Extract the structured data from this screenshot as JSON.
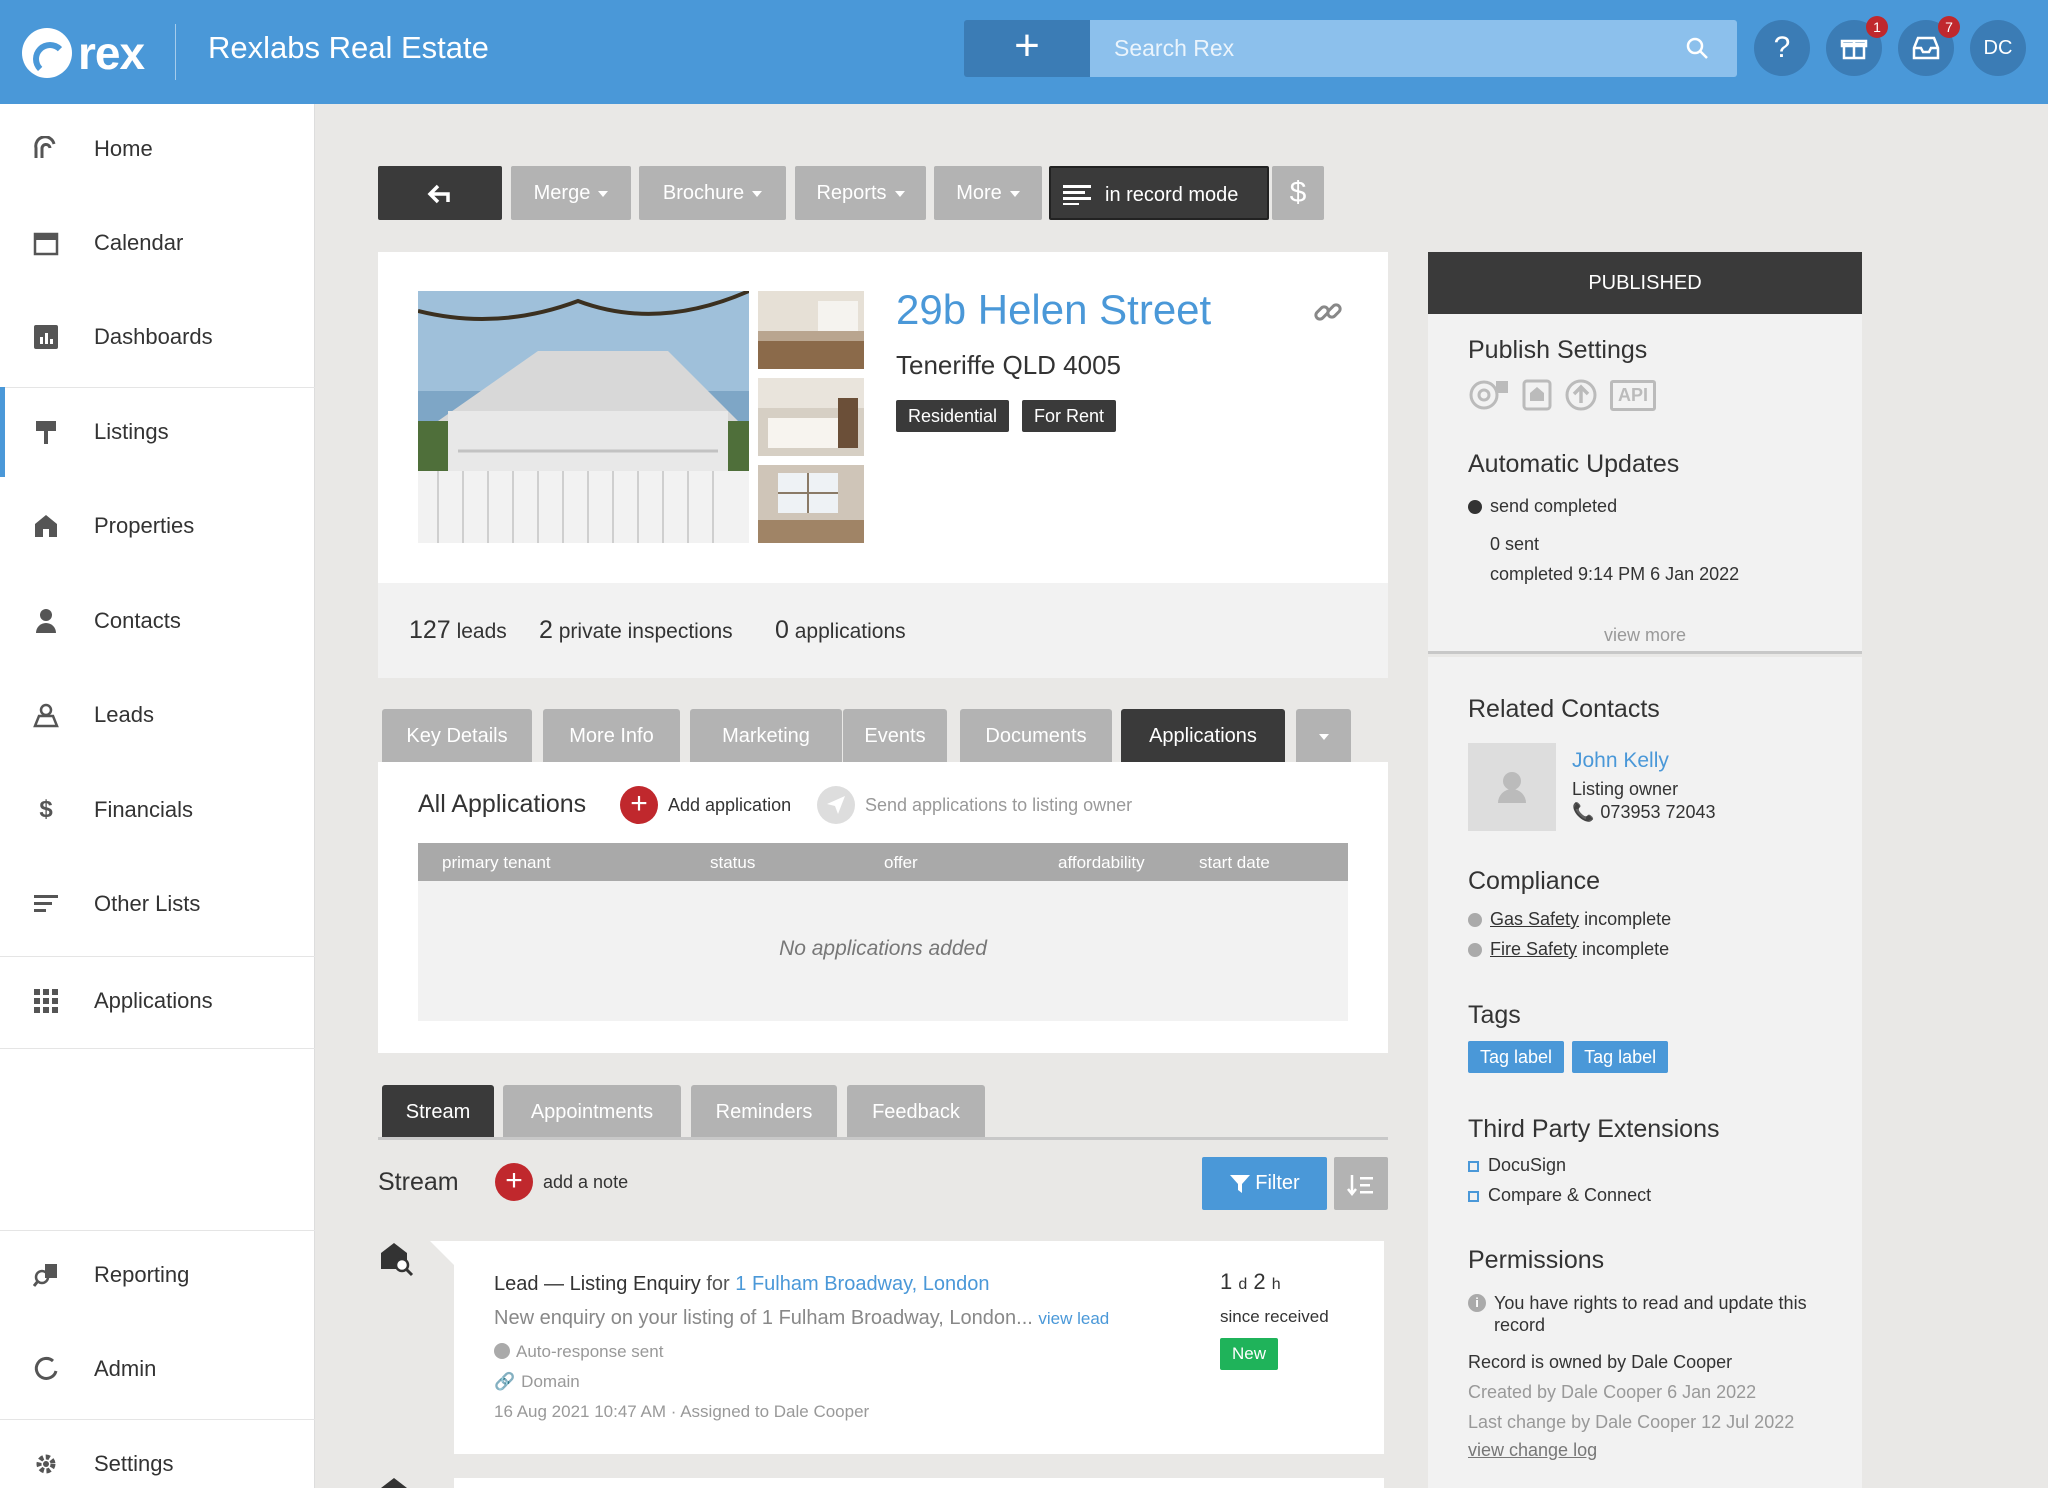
{
  "app": {
    "logo_text": "rex",
    "agency": "Rexlabs Real Estate"
  },
  "topbar": {
    "add_symbol": "+",
    "search_placeholder": "Search Rex",
    "help_symbol": "?",
    "gifts_badge": "1",
    "inbox_badge": "7",
    "user_initials": "DC"
  },
  "sidebar": {
    "items": [
      {
        "label": "Home",
        "icon": "rex-home-icon"
      },
      {
        "label": "Calendar",
        "icon": "calendar-icon"
      },
      {
        "label": "Dashboards",
        "icon": "dashboard-icon"
      },
      {
        "label": "Listings",
        "icon": "sign-icon"
      },
      {
        "label": "Properties",
        "icon": "house-icon"
      },
      {
        "label": "Contacts",
        "icon": "person-icon"
      },
      {
        "label": "Leads",
        "icon": "lead-icon"
      },
      {
        "label": "Financials",
        "icon": "dollar-icon"
      },
      {
        "label": "Other Lists",
        "icon": "lines-icon"
      },
      {
        "label": "Applications",
        "icon": "grid-icon"
      }
    ],
    "bottom": [
      {
        "label": "Reporting",
        "icon": "reporting-icon"
      },
      {
        "label": "Admin",
        "icon": "admin-icon"
      },
      {
        "label": "Settings",
        "icon": "gear-icon"
      }
    ]
  },
  "toolbar": {
    "merge": "Merge",
    "brochure": "Brochure",
    "reports": "Reports",
    "more": "More",
    "record_mode": "in record mode",
    "dollar": "$"
  },
  "listing": {
    "street": "29b Helen Street",
    "suburb": "Teneriffe QLD 4005",
    "tags": [
      "Residential",
      "For Rent"
    ],
    "stats": [
      {
        "num": "127",
        "label": "leads"
      },
      {
        "num": "2",
        "label": "private inspections"
      },
      {
        "num": "0",
        "label": "applications"
      }
    ]
  },
  "tabs": [
    "Key Details",
    "More Info",
    "Marketing",
    "Events",
    "Documents",
    "Applications"
  ],
  "applications": {
    "title": "All Applications",
    "add_label": "Add application",
    "send_label": "Send applications to listing owner",
    "columns": [
      "primary tenant",
      "status",
      "offer",
      "affordability",
      "start date"
    ],
    "empty": "No applications added"
  },
  "stream_tabs": [
    "Stream",
    "Appointments",
    "Reminders",
    "Feedback"
  ],
  "stream": {
    "title": "Stream",
    "add_note": "add a note",
    "filter": "Filter",
    "entry": {
      "type": "Lead — Listing Enquiry",
      "for": "for",
      "link": "1 Fulham Broadway, London",
      "text": "New enquiry on your listing of 1 Fulham Broadway, London...",
      "view_lead": "view lead",
      "auto": "Auto-response sent",
      "source": "Domain",
      "meta": "16 Aug 2021 10:47 AM · Assigned to Dale Cooper",
      "age_d": "1",
      "age_d_unit": "d",
      "age_h": "2",
      "age_h_unit": "h",
      "since": "since received",
      "status": "New"
    }
  },
  "right": {
    "published": "PUBLISHED",
    "publish_settings": "Publish Settings",
    "api": "API",
    "auto_updates": "Automatic Updates",
    "send_completed": "send completed",
    "sent": "0 sent",
    "completed": "completed 9:14 PM 6 Jan 2022",
    "view_more": "view more",
    "related_contacts": "Related Contacts",
    "contact_name": "John Kelly",
    "contact_role": "Listing owner",
    "contact_phone": "073953 72043",
    "compliance": "Compliance",
    "compliance_items": [
      {
        "name": "Gas Safety",
        "status": "incomplete"
      },
      {
        "name": "Fire Safety",
        "status": "incomplete"
      }
    ],
    "tags_title": "Tags",
    "tags": [
      "Tag label",
      "Tag label"
    ],
    "extensions_title": "Third Party Extensions",
    "extensions": [
      "DocuSign",
      "Compare & Connect"
    ],
    "permissions_title": "Permissions",
    "permissions_text": "You have rights to read and update this record",
    "owned": "Record is owned by Dale Cooper",
    "created": "Created by Dale Cooper 6 Jan 2022",
    "changed": "Last change by Dale Cooper 12 Jul 2022",
    "change_log": "view change log"
  },
  "colors": {
    "brand": "#4a98d8",
    "dark": "#3a3a3a",
    "danger": "#c0282d",
    "success": "#1fb35a"
  }
}
